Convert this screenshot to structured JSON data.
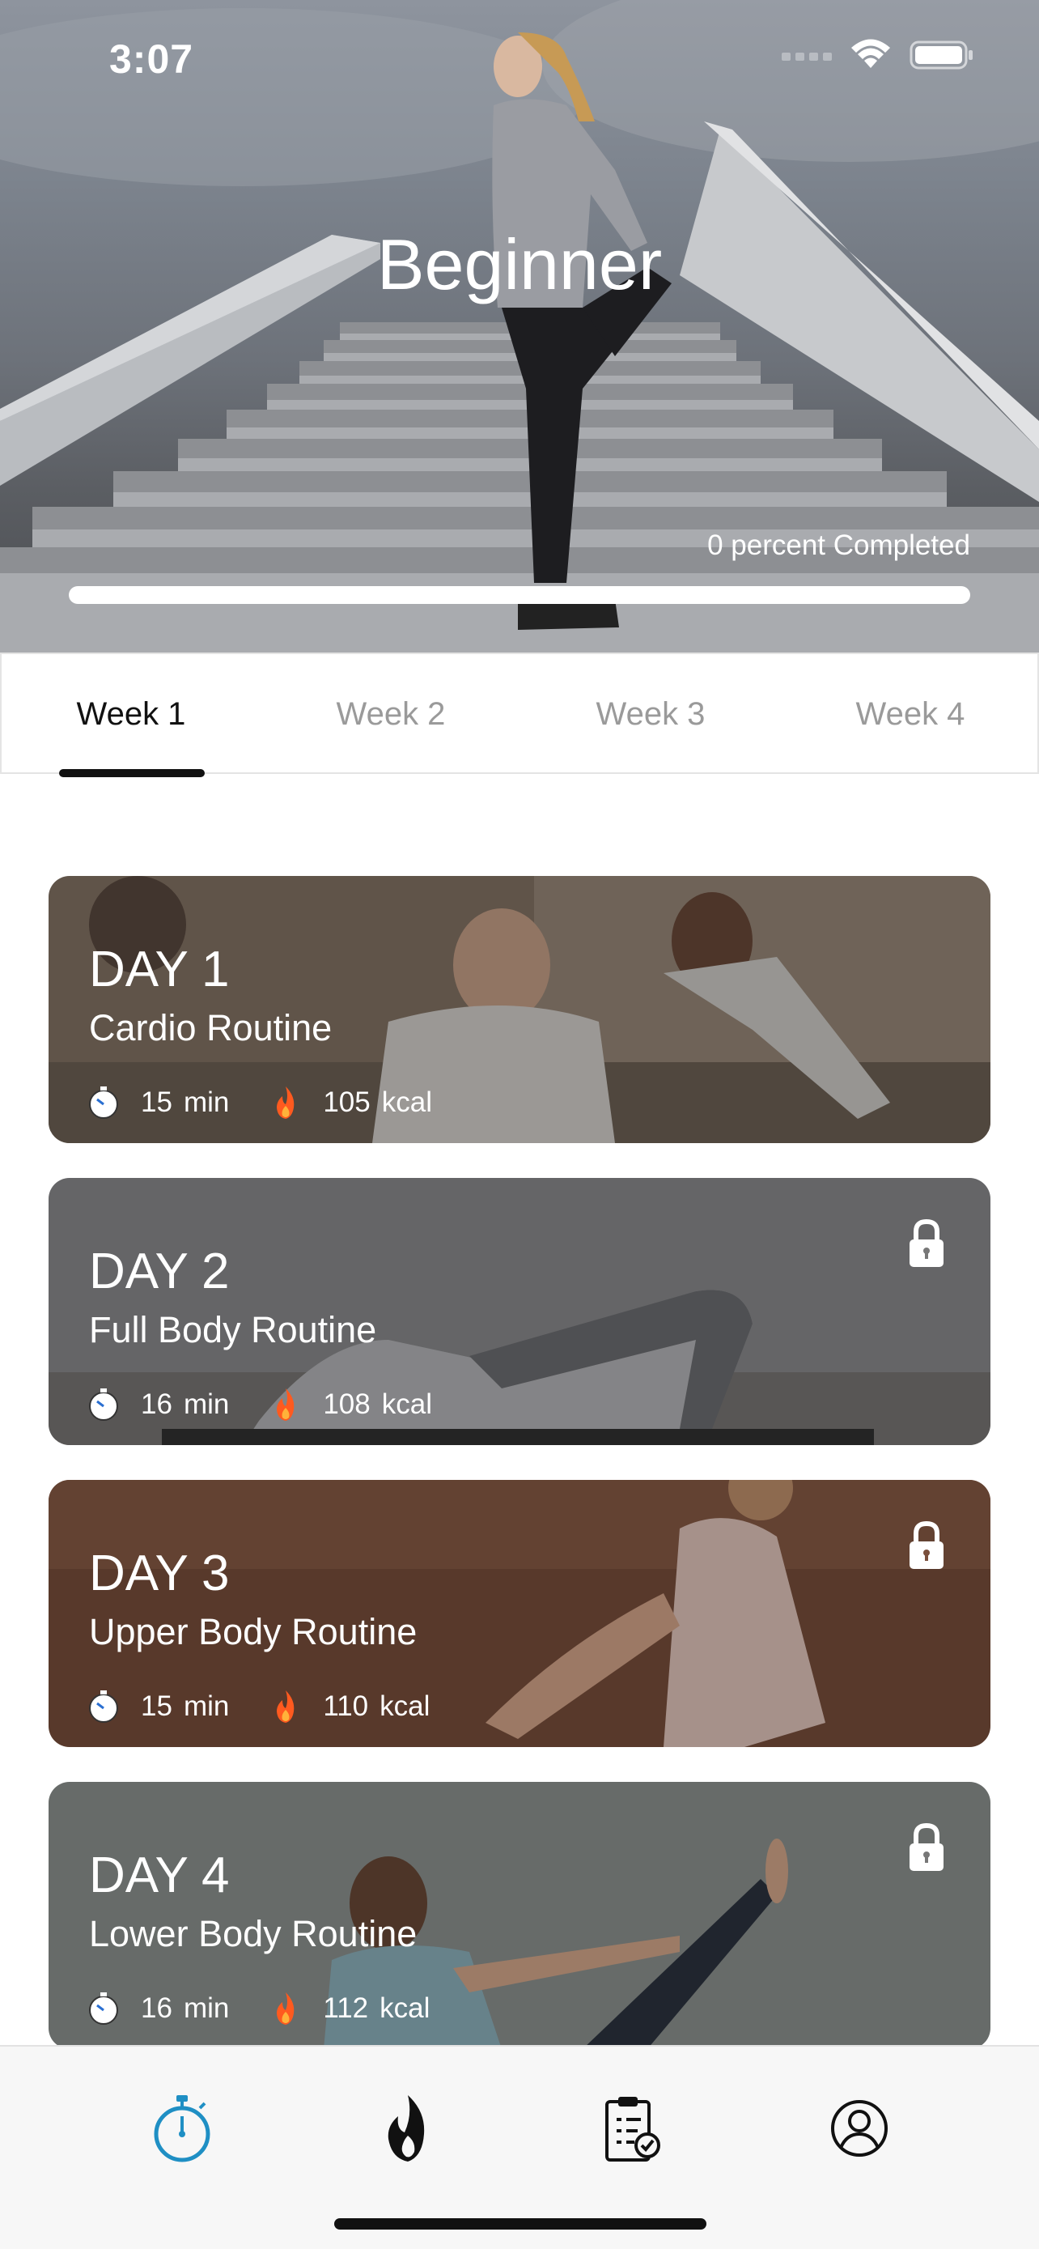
{
  "status_bar": {
    "time": "3:07"
  },
  "hero": {
    "title": "Beginner",
    "progress_label": "0 percent Completed",
    "progress_fraction": 0
  },
  "tabs": [
    {
      "label": "Week 1",
      "active": true
    },
    {
      "label": "Week 2",
      "active": false
    },
    {
      "label": "Week 3",
      "active": false
    },
    {
      "label": "Week 4",
      "active": false
    }
  ],
  "days": [
    {
      "day": "DAY 1",
      "routine": "Cardio Routine",
      "duration": "15",
      "duration_unit": "min",
      "calories": "105",
      "calories_unit": "kcal",
      "locked": false
    },
    {
      "day": "DAY 2",
      "routine": "Full Body Routine",
      "duration": "16",
      "duration_unit": "min",
      "calories": "108",
      "calories_unit": "kcal",
      "locked": true
    },
    {
      "day": "DAY 3",
      "routine": "Upper Body Routine",
      "duration": "15",
      "duration_unit": "min",
      "calories": "110",
      "calories_unit": "kcal",
      "locked": true
    },
    {
      "day": "DAY 4",
      "routine": "Lower Body Routine",
      "duration": "16",
      "duration_unit": "min",
      "calories": "112",
      "calories_unit": "kcal",
      "locked": true
    }
  ],
  "bottom_nav": [
    {
      "icon": "stopwatch-icon",
      "active": true
    },
    {
      "icon": "flame-icon",
      "active": false
    },
    {
      "icon": "clipboard-check-icon",
      "active": false
    },
    {
      "icon": "profile-icon",
      "active": false
    }
  ],
  "colors": {
    "accent": "#1f8fc4",
    "flame": "#ff5a1f",
    "tab_active": "#111111",
    "tab_inactive": "#9a9a9a"
  }
}
